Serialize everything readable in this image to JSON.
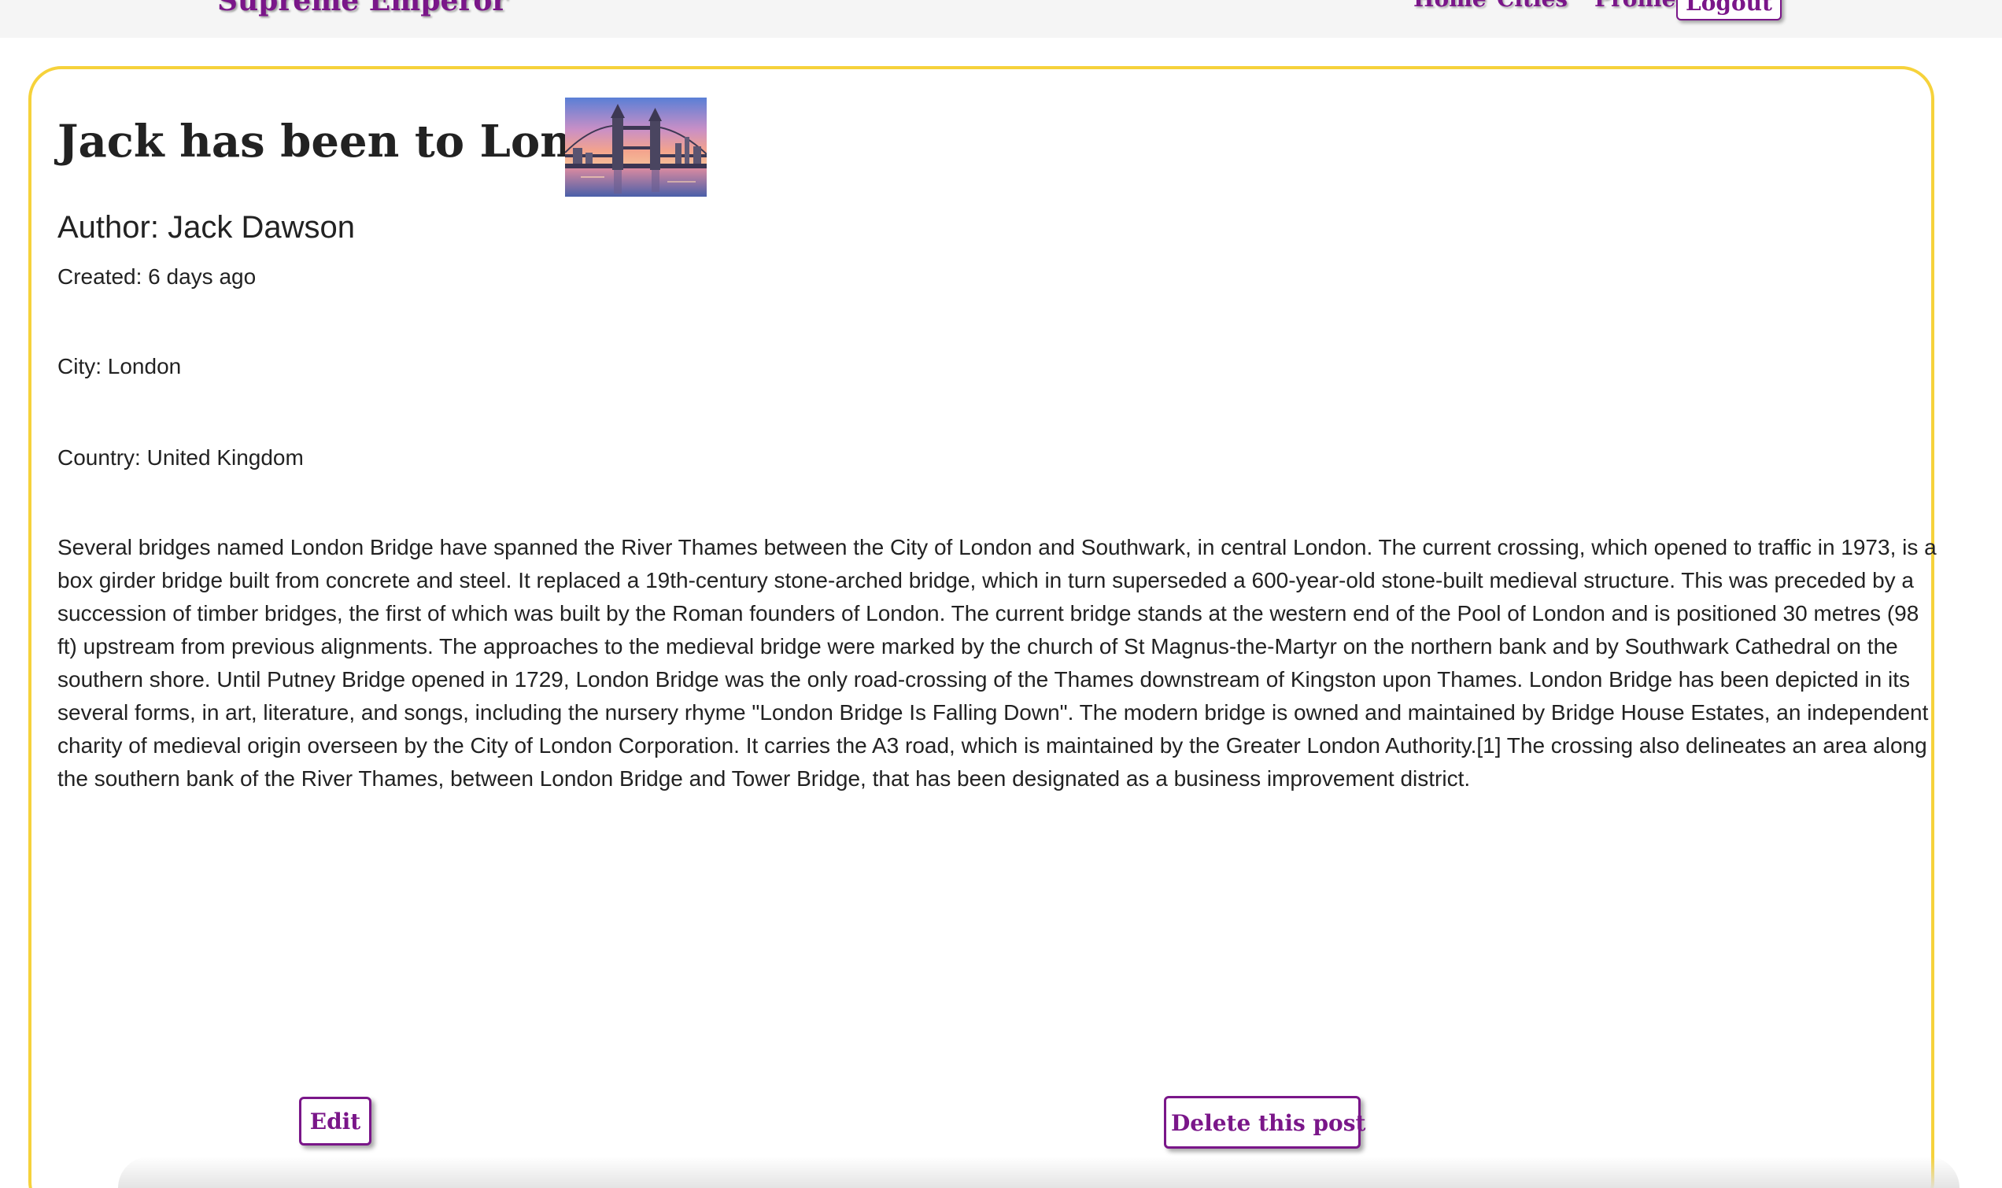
{
  "nav": {
    "brand": "Supreme Emperor",
    "links": [
      "Home",
      "Cities",
      "Profile"
    ],
    "logout_label": "Logout"
  },
  "post": {
    "title": "Jack has been to London",
    "image_alt": "Tower Bridge at sunset",
    "author": "Author: Jack Dawson",
    "created": "Created: 6 days ago",
    "city": "City: London",
    "country": "Country: United Kingdom",
    "body": "Several bridges named London Bridge have spanned the River Thames between the City of London and Southwark, in central London. The current crossing, which opened to traffic in 1973, is a box girder bridge built from concrete and steel. It replaced a 19th-century stone-arched bridge, which in turn superseded a 600-year-old stone-built medieval structure. This was preceded by a succession of timber bridges, the first of which was built by the Roman founders of London. The current bridge stands at the western end of the Pool of London and is positioned 30 metres (98 ft) upstream from previous alignments. The approaches to the medieval bridge were marked by the church of St Magnus-the-Martyr on the northern bank and by Southwark Cathedral on the southern shore. Until Putney Bridge opened in 1729, London Bridge was the only road-crossing of the Thames downstream of Kingston upon Thames. London Bridge has been depicted in its several forms, in art, literature, and songs, including the nursery rhyme \"London Bridge Is Falling Down\". The modern bridge is owned and maintained by Bridge House Estates, an independent charity of medieval origin overseen by the City of London Corporation. It carries the A3 road, which is maintained by the Greater London Authority.[1] The crossing also delineates an area along the southern bank of the River Thames, between London Bridge and Tower Bridge, that has been designated as a business improvement district."
  },
  "actions": {
    "edit_label": "Edit",
    "delete_label": "Delete this post"
  },
  "colors": {
    "brand": "#7a1689",
    "card_border": "#f6d23b",
    "text": "#222222",
    "topbar_bg": "#f5f5f5"
  }
}
